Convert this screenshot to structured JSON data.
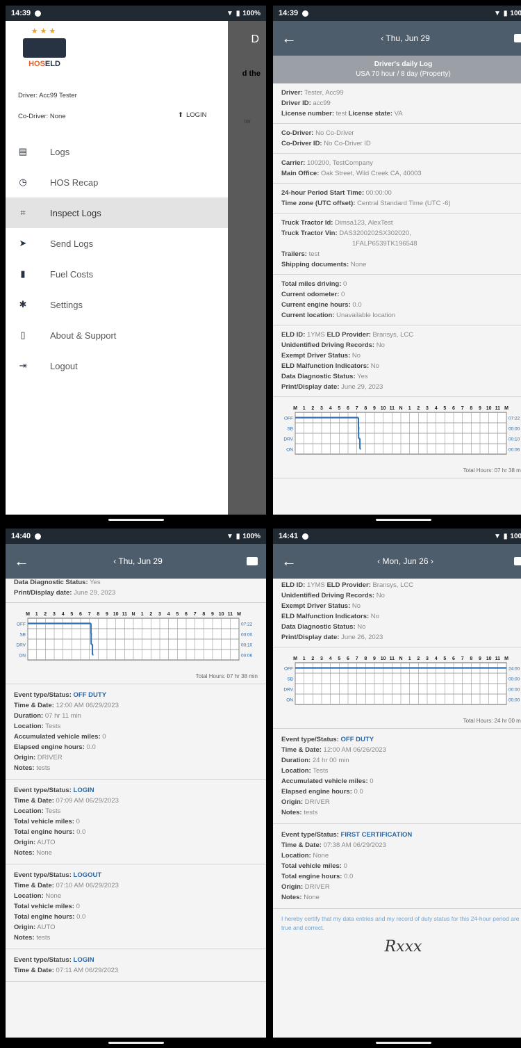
{
  "status": {
    "p1_time": "14:39",
    "p2_time": "14:39",
    "p3_time": "14:40",
    "p4_time": "14:41",
    "battery": "100%"
  },
  "drawer": {
    "driver": "Driver: Acc99 Tester",
    "codriver": "Co-Driver: None",
    "login": "LOGIN",
    "logo_stars": "★★★",
    "logo_hos": "HOS",
    "logo_eld": "ELD",
    "items": [
      {
        "label": "Logs",
        "icon": "list-icon"
      },
      {
        "label": "HOS Recap",
        "icon": "clock-icon"
      },
      {
        "label": "Inspect Logs",
        "icon": "inspect-icon"
      },
      {
        "label": "Send Logs",
        "icon": "send-icon"
      },
      {
        "label": "Fuel Costs",
        "icon": "fuel-icon"
      },
      {
        "label": "Settings",
        "icon": "gear-icon"
      },
      {
        "label": "About & Support",
        "icon": "phone-icon"
      },
      {
        "label": "Logout",
        "icon": "logout-icon"
      }
    ],
    "bg_letter": "D",
    "bg_text1": "d the",
    "bg_text2": "ter"
  },
  "p2": {
    "title": "Thu, Jun 29",
    "header_title": "Driver's daily Log",
    "header_sub": "USA 70 hour / 8 day (Property)",
    "sections": [
      [
        [
          "Driver:",
          "Tester, Acc99"
        ],
        [
          "Driver ID:",
          "acc99"
        ],
        [
          "License number:",
          "test",
          "License state:",
          "VA"
        ]
      ],
      [
        [
          "Co-Driver:",
          "No Co-Driver"
        ],
        [
          "Co-Driver ID:",
          "No Co-Driver ID"
        ]
      ],
      [
        [
          "Carrier:",
          "100200, TestCompany"
        ],
        [
          "Main Office:",
          "Oak Street, Wild Creek CA, 40003"
        ]
      ],
      [
        [
          "24-hour Period Start Time:",
          "00:00:00"
        ],
        [
          "Time zone (UTC offset):",
          "Central Standard Time (UTC -6)"
        ]
      ],
      [
        [
          "Truck Tractor Id:",
          "Dimsa123, AlexTest"
        ],
        [
          "Truck Tractor Vin:",
          "DAS3200202SX302020,"
        ],
        [
          "",
          "1FALP6539TK196548"
        ],
        [
          "Trailers:",
          "test"
        ],
        [
          "Shipping documents:",
          "None"
        ]
      ],
      [
        [
          "Total miles driving:",
          "0"
        ],
        [
          "Current odometer:",
          "0"
        ],
        [
          "Current engine hours:",
          "0.0"
        ],
        [
          "Current location:",
          "Unavailable location"
        ]
      ],
      [
        [
          "ELD ID:",
          "1YMS",
          "ELD Provider:",
          "Bransys, LCC"
        ],
        [
          "Unidentified Driving Records:",
          "No"
        ],
        [
          "Exempt Driver Status:",
          "No"
        ],
        [
          "ELD Malfunction Indicators:",
          "No"
        ],
        [
          "Data Diagnostic Status:",
          "Yes"
        ],
        [
          "Print/Display date:",
          "June 29, 2023"
        ]
      ]
    ],
    "total": "Total Hours: 07 hr 38 min",
    "totals": [
      "07:22",
      "00:00",
      "00:10",
      "00:06"
    ]
  },
  "p3": {
    "title": "Thu, Jun 29",
    "top_rows": [
      [
        "Data Diagnostic Status:",
        "Yes"
      ],
      [
        "Print/Display date:",
        "June 29, 2023"
      ]
    ],
    "total": "Total Hours: 07 hr 38 min",
    "totals": [
      "07:22",
      "00:00",
      "00:10",
      "00:06"
    ],
    "events": [
      [
        [
          "Event type/Status:",
          "OFF DUTY",
          1
        ],
        [
          "Time & Date:",
          "12:00 AM 06/29/2023"
        ],
        [
          "Duration:",
          "07 hr 11 min"
        ],
        [
          "Location:",
          "Tests"
        ],
        [
          "Accumulated vehicle miles:",
          "0"
        ],
        [
          "Elapsed engine hours:",
          "0.0"
        ],
        [
          "Origin:",
          "DRIVER"
        ],
        [
          "Notes:",
          "tests"
        ]
      ],
      [
        [
          "Event type/Status:",
          "LOGIN",
          1
        ],
        [
          "Time & Date:",
          "07:09 AM 06/29/2023"
        ],
        [
          "Location:",
          "Tests"
        ],
        [
          "Total vehicle miles:",
          "0"
        ],
        [
          "Total engine hours:",
          "0.0"
        ],
        [
          "Origin:",
          "AUTO"
        ],
        [
          "Notes:",
          "None"
        ]
      ],
      [
        [
          "Event type/Status:",
          "LOGOUT",
          1
        ],
        [
          "Time & Date:",
          "07:10 AM 06/29/2023"
        ],
        [
          "Location:",
          "None"
        ],
        [
          "Total vehicle miles:",
          "0"
        ],
        [
          "Total engine hours:",
          "0.0"
        ],
        [
          "Origin:",
          "AUTO"
        ],
        [
          "Notes:",
          "tests"
        ]
      ],
      [
        [
          "Event type/Status:",
          "LOGIN",
          1
        ],
        [
          "Time & Date:",
          "07:11 AM 06/29/2023"
        ]
      ]
    ]
  },
  "p4": {
    "title": "Mon, Jun 26",
    "top_rows": [
      [
        "ELD ID:",
        "1YMS",
        "ELD Provider:",
        "Bransys, LCC"
      ],
      [
        "Unidentified Driving Records:",
        "No"
      ],
      [
        "Exempt Driver Status:",
        "No"
      ],
      [
        "ELD Malfunction Indicators:",
        "No"
      ],
      [
        "Data Diagnostic Status:",
        "No"
      ],
      [
        "Print/Display date:",
        "June 26, 2023"
      ]
    ],
    "total": "Total Hours: 24 hr 00 min",
    "totals": [
      "24:00",
      "00:00",
      "00:00",
      "00:00"
    ],
    "events": [
      [
        [
          "Event type/Status:",
          "OFF DUTY",
          1
        ],
        [
          "Time & Date:",
          "12:00 AM 06/26/2023"
        ],
        [
          "Duration:",
          "24 hr 00 min"
        ],
        [
          "Location:",
          "Tests"
        ],
        [
          "Accumulated vehicle miles:",
          "0"
        ],
        [
          "Elapsed engine hours:",
          "0.0"
        ],
        [
          "Origin:",
          "DRIVER"
        ],
        [
          "Notes:",
          "tests"
        ]
      ],
      [
        [
          "Event type/Status:",
          "FIRST CERTIFICATION",
          1
        ],
        [
          "Time & Date:",
          "07:38 AM 06/29/2023"
        ],
        [
          "Location:",
          "None"
        ],
        [
          "Total vehicle miles:",
          "0"
        ],
        [
          "Total engine hours:",
          "0.0"
        ],
        [
          "Origin:",
          "DRIVER"
        ],
        [
          "Notes:",
          "None"
        ]
      ]
    ],
    "cert": "I hereby certify that my data entries and my record of duty status for this 24-hour period are true and correct.",
    "signature": "Rxxx"
  },
  "chart_labels": {
    "status": [
      "OFF",
      "SB",
      "DRV",
      "ON"
    ],
    "hours": [
      "M",
      "1",
      "2",
      "3",
      "4",
      "5",
      "6",
      "7",
      "8",
      "9",
      "10",
      "11",
      "N",
      "1",
      "2",
      "3",
      "4",
      "5",
      "6",
      "7",
      "8",
      "9",
      "10",
      "11",
      "M"
    ]
  },
  "chart_data": [
    {
      "type": "line",
      "title": "",
      "segments": [
        {
          "status": "OFF",
          "from": 0,
          "to": 7.18
        },
        {
          "status": "SB",
          "from": 7.18,
          "to": 7.2
        },
        {
          "status": "DRV",
          "from": 7.2,
          "to": 7.35
        },
        {
          "status": "ON",
          "from": 7.35,
          "to": 7.45
        }
      ],
      "totals": [
        "07:22",
        "00:00",
        "00:10",
        "00:06"
      ]
    },
    {
      "type": "line",
      "title": "",
      "segments": [
        {
          "status": "OFF",
          "from": 0,
          "to": 24
        }
      ],
      "totals": [
        "24:00",
        "00:00",
        "00:00",
        "00:00"
      ]
    }
  ]
}
